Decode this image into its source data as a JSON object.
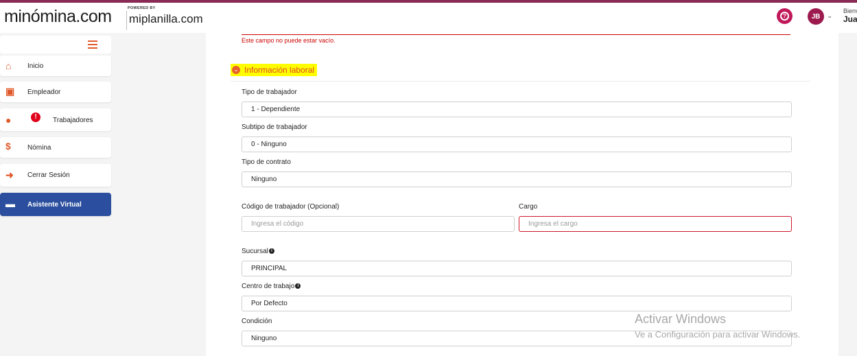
{
  "header": {
    "logo_text": "minómina.com",
    "powered_by": "POWERED BY",
    "partner": "miplanilla.com",
    "welcome": "Bienv",
    "username": "Jua",
    "avatar_initials": "JB",
    "help_icon": "help-circle-icon"
  },
  "sidebar": {
    "items": [
      {
        "label": "Inicio",
        "icon": "home-icon"
      },
      {
        "label": "Empleador",
        "icon": "id-badge-icon"
      },
      {
        "label": "Trabajadores",
        "icon": "users-icon",
        "badge": "!"
      },
      {
        "label": "Nómina",
        "icon": "dollar-icon"
      },
      {
        "label": "Cerrar Sesión",
        "icon": "sign-out-icon"
      },
      {
        "label": "Asistente Virtual",
        "icon": "chat-bubble-icon"
      }
    ]
  },
  "form": {
    "error_message": "Este campo no puede estar vacío.",
    "section_title": "Información laboral",
    "tipo_trabajador": {
      "label": "Tipo de trabajador",
      "value": "1 - Dependiente"
    },
    "subtipo_trabajador": {
      "label": "Subtipo de trabajador",
      "value": "0 - Ninguno"
    },
    "tipo_contrato": {
      "label": "Tipo de contrato",
      "value": "Ninguno"
    },
    "codigo_trabajador": {
      "label": "Código de trabajador (Opcional)",
      "placeholder": "Ingresa el código"
    },
    "cargo": {
      "label": "Cargo",
      "placeholder": "Ingresa el cargo"
    },
    "sucursal": {
      "label": "Sucursal",
      "value": "PRINCIPAL"
    },
    "centro_trabajo": {
      "label": "Centro de trabajo",
      "value": "Por Defecto"
    },
    "condicion": {
      "label": "Condición",
      "value": "Ninguno"
    }
  },
  "watermark": {
    "title": "Activar Windows",
    "subtitle": "Ve a Configuración para activar Windows."
  },
  "colors": {
    "brand": "#8b2b55",
    "accent": "#e0592a",
    "error": "#d2142a",
    "virtual_assistant": "#2b4f9e"
  }
}
